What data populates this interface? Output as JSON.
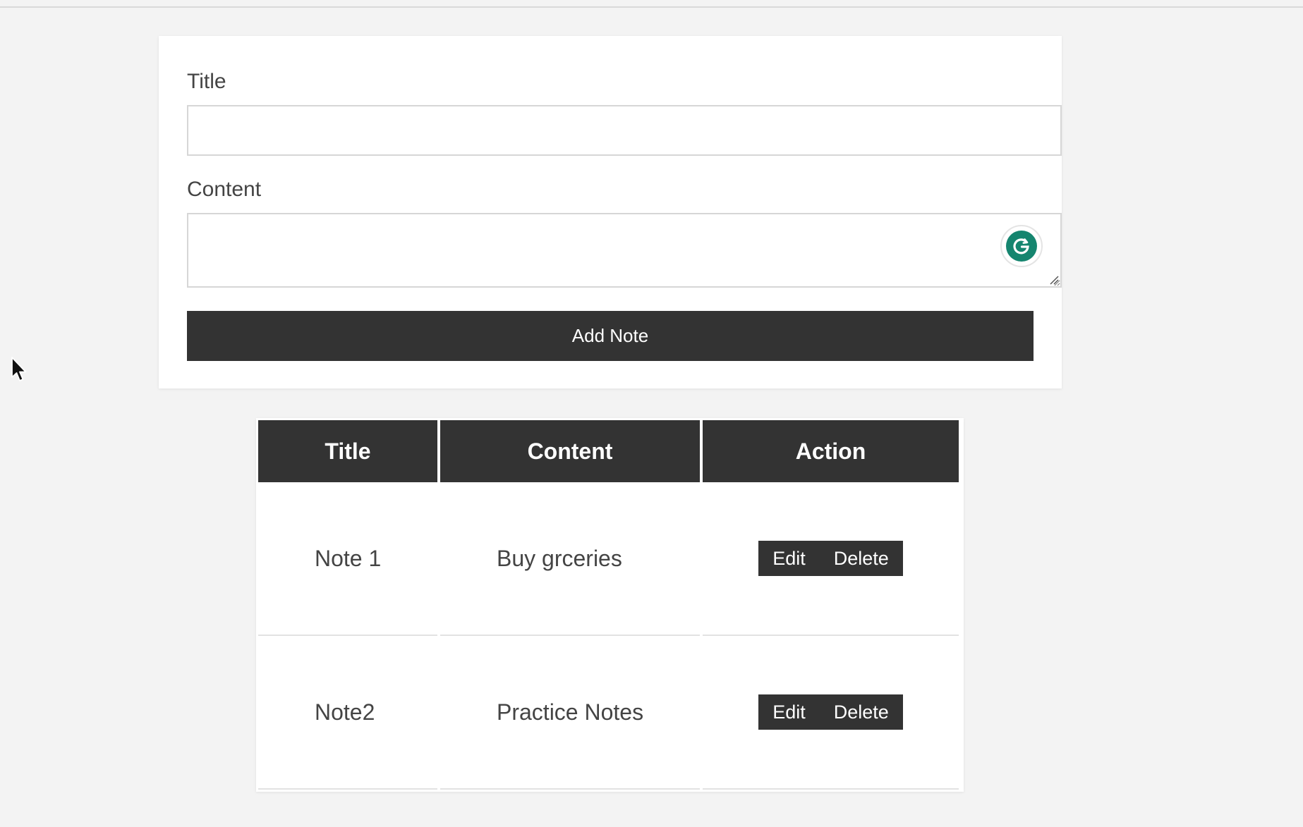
{
  "form": {
    "title_label": "Title",
    "title_value": "",
    "title_placeholder": "",
    "content_label": "Content",
    "content_value": "",
    "content_placeholder": "",
    "submit_label": "Add Note"
  },
  "table": {
    "headers": [
      "Title",
      "Content",
      "Action"
    ],
    "rows": [
      {
        "title": "Note 1",
        "content": "Buy grceries",
        "edit_label": "Edit",
        "delete_label": "Delete"
      },
      {
        "title": "Note2",
        "content": "Practice Notes",
        "edit_label": "Edit",
        "delete_label": "Delete"
      }
    ]
  },
  "icons": {
    "grammarly": "grammarly-icon",
    "cursor": "mouse-pointer-icon",
    "resize": "resize-grip-icon"
  },
  "colors": {
    "page_bg": "#f3f3f3",
    "card_bg": "#ffffff",
    "dark_button": "#333333",
    "grammarly_green": "#15856f",
    "text": "#444444"
  }
}
